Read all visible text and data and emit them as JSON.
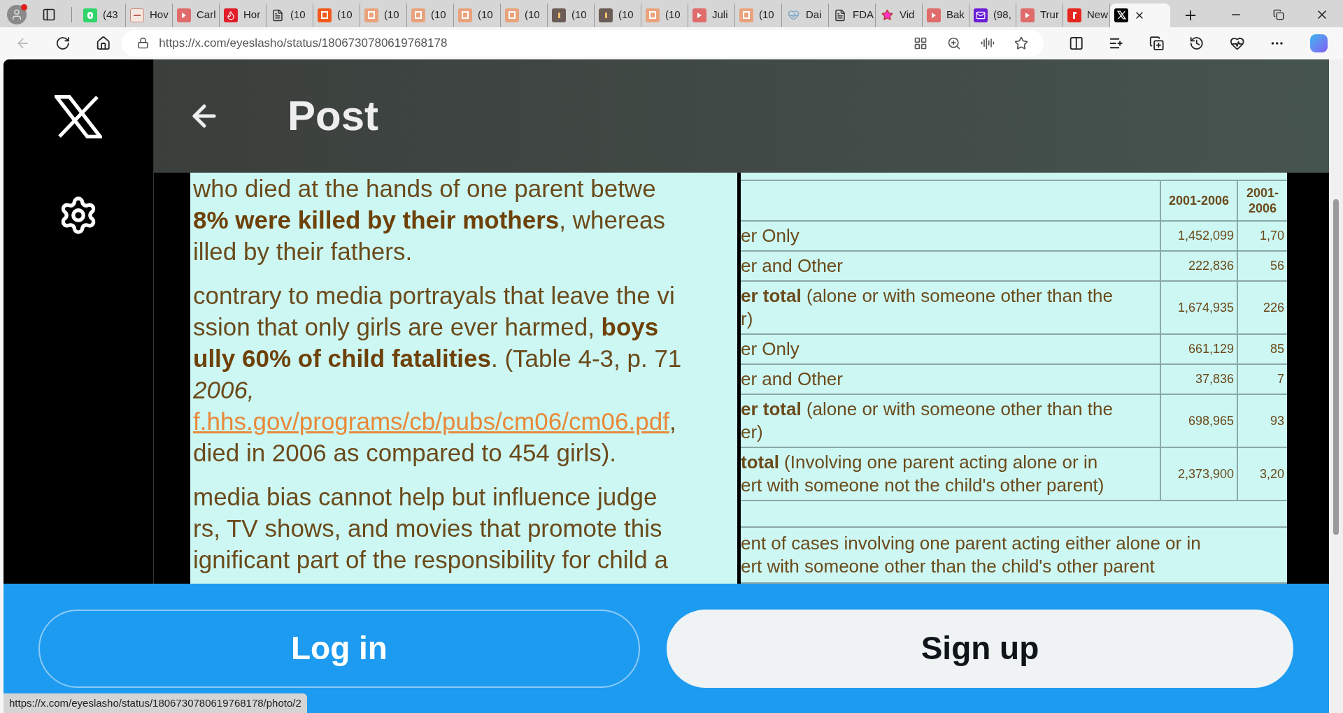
{
  "browser": {
    "tabs": [
      {
        "kind": "g",
        "title": "(43",
        "selected": false
      },
      {
        "kind": "bi",
        "title": "Hov",
        "selected": false
      },
      {
        "kind": "video",
        "title": "Carl",
        "selected": false
      },
      {
        "kind": "torch",
        "title": "Hor",
        "selected": false
      },
      {
        "kind": "doc",
        "title": "(10",
        "selected": false
      },
      {
        "kind": "bookmark",
        "title": "(10",
        "selected": false
      },
      {
        "kind": "bookmark-light",
        "title": "(10",
        "selected": false
      },
      {
        "kind": "bookmark-light",
        "title": "(10",
        "selected": false
      },
      {
        "kind": "bookmark-light",
        "title": "(10",
        "selected": false
      },
      {
        "kind": "bookmark-light",
        "title": "(10",
        "selected": false
      },
      {
        "kind": "candle",
        "title": "(10",
        "selected": false
      },
      {
        "kind": "candle",
        "title": "(10",
        "selected": false
      },
      {
        "kind": "bookmark-light",
        "title": "(10",
        "selected": false
      },
      {
        "kind": "video",
        "title": "Juli",
        "selected": false
      },
      {
        "kind": "bookmark-light",
        "title": "(10",
        "selected": false
      },
      {
        "kind": "heart",
        "title": "Dai",
        "selected": false
      },
      {
        "kind": "doc",
        "title": "FDA",
        "selected": false
      },
      {
        "kind": "star",
        "title": "Vid",
        "selected": false
      },
      {
        "kind": "video",
        "title": "Bak",
        "selected": false
      },
      {
        "kind": "mail",
        "title": "(98,",
        "selected": false
      },
      {
        "kind": "video",
        "title": "Trur",
        "selected": false
      },
      {
        "kind": "r",
        "title": "New",
        "selected": false
      },
      {
        "kind": "x",
        "selected": true
      }
    ],
    "address": "https://x.com/eyeslasho/status/1806730780619768178",
    "status_url": "https://x.com/eyeslasho/status/1806730780619768178/photo/2"
  },
  "header": {
    "title": "Post"
  },
  "document": {
    "paragraphs": [
      {
        "lines": [
          {
            "kind": "text",
            "text": "who died at the hands of one parent betwe"
          },
          {
            "kind": "text",
            "text": "**8% were killed by their mothers**, whereas"
          },
          {
            "kind": "text",
            "text": "illed by their fathers."
          }
        ]
      },
      {
        "lines": [
          {
            "kind": "text",
            "text": "contrary to media portrayals that leave the vi"
          },
          {
            "kind": "text",
            "text": "ssion that only girls are ever harmed, **boys**"
          },
          {
            "kind": "text",
            "text": "**ully 60% of child fatalities**. (Table 4-3, p. 71"
          },
          {
            "kind": "italic",
            "text": "2006,"
          },
          {
            "kind": "link",
            "text": "f.hhs.gov/programs/cb/pubs/cm06/cm06.pdf",
            "tail": ","
          },
          {
            "kind": "text",
            "text": "died in 2006 as compared to 454 girls)."
          }
        ]
      },
      {
        "lines": [
          {
            "kind": "text",
            "text": "media bias cannot help but influence judge"
          },
          {
            "kind": "text",
            "text": "rs, TV shows, and movies that promote this"
          },
          {
            "kind": "text",
            "text": "ignificant part of the responsibility for child a"
          }
        ]
      }
    ]
  },
  "table": {
    "columns": [
      "2001-2006",
      "2001-2006"
    ],
    "rows": [
      {
        "label": [
          "er Only"
        ],
        "values": [
          "1,452,099",
          "1,70"
        ]
      },
      {
        "label": [
          "er and Other"
        ],
        "values": [
          "222,836",
          "56"
        ]
      },
      {
        "label": [
          "**er total** (alone or with someone other than the",
          "r)"
        ],
        "values": [
          "1,674,935",
          "226"
        ]
      },
      {
        "label": [
          "er Only"
        ],
        "values": [
          "661,129",
          "85"
        ]
      },
      {
        "label": [
          "er and Other"
        ],
        "values": [
          "37,836",
          "7"
        ]
      },
      {
        "label": [
          "**er total** (alone or with someone other than the",
          "er)"
        ],
        "values": [
          "698,965",
          "93"
        ]
      },
      {
        "label": [
          "**total** (Involving one parent acting alone or in",
          "ert with someone not the child's other parent)"
        ],
        "values": [
          "2,373,900",
          "3,20"
        ]
      }
    ],
    "note": [
      "ent of cases involving one parent acting either alone or in",
      "ert with someone other than the child's other parent"
    ]
  },
  "actions": [
    {
      "kind": "outline",
      "label": "Log in"
    },
    {
      "kind": "filled",
      "label": "Sign up"
    }
  ]
}
